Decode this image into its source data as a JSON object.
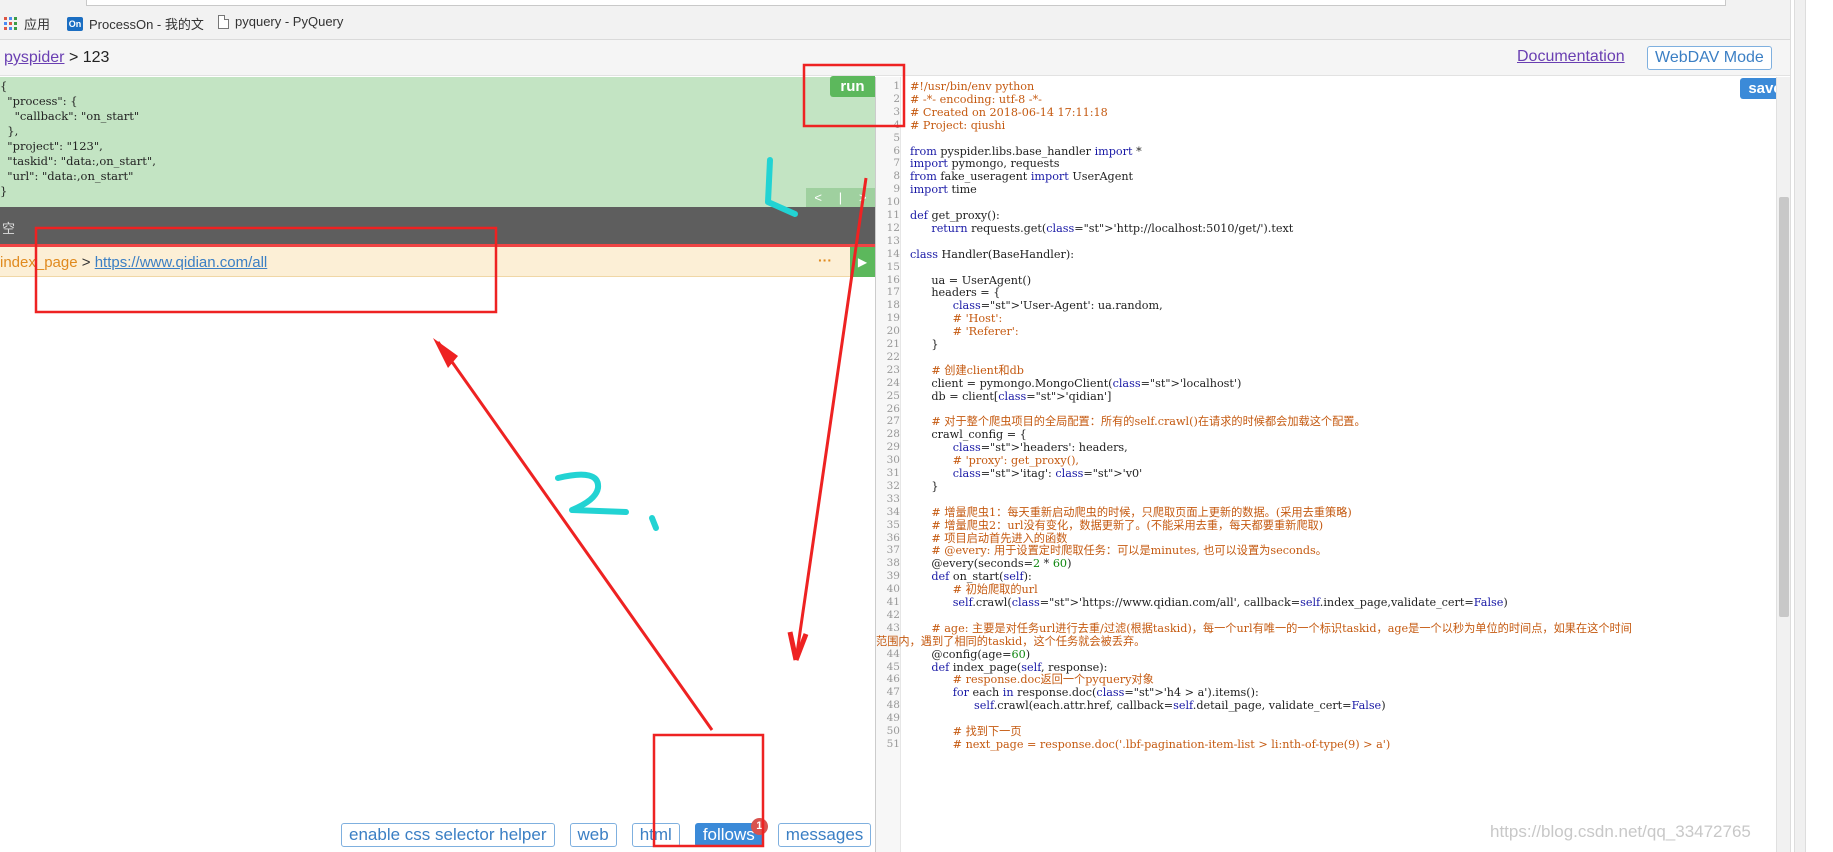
{
  "bookmarks": {
    "apps": "应用",
    "processon": "ProcessOn - 我的文",
    "pyquery": "pyquery - PyQuery"
  },
  "header": {
    "root_link": "pyspider",
    "separator": ">",
    "project": "123",
    "documentation": "Documentation",
    "webdav": "WebDAV Mode"
  },
  "task": {
    "json": "{\n  \"process\": {\n    \"callback\": \"on_start\"\n  },\n  \"project\": \"123\",\n  \"taskid\": \"data:,on_start\",\n  \"url\": \"data:,on_start\"\n}",
    "run_label": "run",
    "prev": "<",
    "next": ">"
  },
  "gray_bar_text": "空",
  "url_bar": {
    "callback": "index_page",
    "separator": ">",
    "url": "https://www.qidian.com/all",
    "more": "···",
    "play": "▶"
  },
  "tabs": [
    {
      "label": "enable css selector helper"
    },
    {
      "label": "web"
    },
    {
      "label": "html"
    },
    {
      "label": "follows",
      "badge": "1",
      "active": true
    },
    {
      "label": "messages"
    }
  ],
  "editor": {
    "save_label": "save",
    "lines": [
      {
        "n": "1",
        "t": "#!/usr/bin/env python",
        "k": "cm"
      },
      {
        "n": "2",
        "t": "# -*- encoding: utf-8 -*-",
        "k": "cm"
      },
      {
        "n": "3",
        "t": "# Created on 2018-06-14 17:11:18",
        "k": "cm"
      },
      {
        "n": "4",
        "t": "# Project: qiushi",
        "k": "cm"
      },
      {
        "n": "5",
        "t": "",
        "k": ""
      },
      {
        "n": "6",
        "t": "from pyspider.libs.base_handler import *",
        "k": ""
      },
      {
        "n": "7",
        "t": "import pymongo, requests",
        "k": ""
      },
      {
        "n": "8",
        "t": "from fake_useragent import UserAgent",
        "k": ""
      },
      {
        "n": "9",
        "t": "import time",
        "k": ""
      },
      {
        "n": "10",
        "t": "",
        "k": ""
      },
      {
        "n": "11",
        "t": "def get_proxy():",
        "k": ""
      },
      {
        "n": "12",
        "t": "      return requests.get('http://localhost:5010/get/').text",
        "k": ""
      },
      {
        "n": "13",
        "t": "",
        "k": ""
      },
      {
        "n": "14",
        "t": "class Handler(BaseHandler):",
        "k": ""
      },
      {
        "n": "15",
        "t": "",
        "k": ""
      },
      {
        "n": "16",
        "t": "      ua = UserAgent()",
        "k": ""
      },
      {
        "n": "17",
        "t": "      headers = {",
        "k": ""
      },
      {
        "n": "18",
        "t": "            'User-Agent': ua.random,",
        "k": ""
      },
      {
        "n": "19",
        "t": "            # 'Host':",
        "k": "cm"
      },
      {
        "n": "20",
        "t": "            # 'Referer':",
        "k": "cm"
      },
      {
        "n": "21",
        "t": "      }",
        "k": ""
      },
      {
        "n": "22",
        "t": "",
        "k": ""
      },
      {
        "n": "23",
        "t": "      # 创建client和db",
        "k": "cm"
      },
      {
        "n": "24",
        "t": "      client = pymongo.MongoClient('localhost')",
        "k": ""
      },
      {
        "n": "25",
        "t": "      db = client['qidian']",
        "k": ""
      },
      {
        "n": "26",
        "t": "",
        "k": ""
      },
      {
        "n": "27",
        "t": "      # 对于整个爬虫项目的全局配置：所有的self.crawl()在请求的时候都会加载这个配置。",
        "k": "cm"
      },
      {
        "n": "28",
        "t": "      crawl_config = {",
        "k": ""
      },
      {
        "n": "29",
        "t": "            'headers': headers,",
        "k": ""
      },
      {
        "n": "30",
        "t": "            # 'proxy': get_proxy(),",
        "k": "cm"
      },
      {
        "n": "31",
        "t": "            'itag': 'v0'",
        "k": ""
      },
      {
        "n": "32",
        "t": "      }",
        "k": ""
      },
      {
        "n": "33",
        "t": "",
        "k": ""
      },
      {
        "n": "34",
        "t": "      # 增量爬虫1：每天重新启动爬虫的时候，只爬取页面上更新的数据。(采用去重策略)",
        "k": "cm"
      },
      {
        "n": "35",
        "t": "      # 增量爬虫2：url没有变化，数据更新了。(不能采用去重，每天都要重新爬取)",
        "k": "cm"
      },
      {
        "n": "36",
        "t": "      # 项目启动首先进入的函数",
        "k": "cm"
      },
      {
        "n": "37",
        "t": "      # @every: 用于设置定时爬取任务：可以是minutes, 也可以设置为seconds。",
        "k": "cm"
      },
      {
        "n": "38",
        "t": "      @every(seconds=2 * 60)",
        "k": ""
      },
      {
        "n": "39",
        "t": "      def on_start(self):",
        "k": ""
      },
      {
        "n": "40",
        "t": "            # 初始爬取的url",
        "k": "cm"
      },
      {
        "n": "41",
        "t": "            self.crawl('https://www.qidian.com/all', callback=self.index_page,validate_cert=False)",
        "k": ""
      },
      {
        "n": "42",
        "t": "",
        "k": ""
      },
      {
        "n": "43",
        "t": "      # age: 主要是对任务url进行去重/过滤(根据taskid)，每一个url有唯一的一个标识taskid，age是一个以秒为单位的时间点，如果在这个时间",
        "k": "cm"
      },
      {
        "n": "",
        "t": "范围内，遇到了相同的taskid，这个任务就会被丢弃。",
        "k": "cm",
        "wrap": true
      },
      {
        "n": "44",
        "t": "      @config(age=60)",
        "k": ""
      },
      {
        "n": "45",
        "t": "      def index_page(self, response):",
        "k": ""
      },
      {
        "n": "46",
        "t": "            # response.doc返回一个pyquery对象",
        "k": "cm"
      },
      {
        "n": "47",
        "t": "            for each in response.doc('h4 > a').items():",
        "k": ""
      },
      {
        "n": "48",
        "t": "                  self.crawl(each.attr.href, callback=self.detail_page, validate_cert=False)",
        "k": ""
      },
      {
        "n": "49",
        "t": "",
        "k": ""
      },
      {
        "n": "50",
        "t": "            # 找到下一页",
        "k": "cm"
      },
      {
        "n": "51",
        "t": "            # next_page = response.doc('.lbf-pagination-item-list > li:nth-of-type(9) > a')",
        "k": "cm"
      }
    ]
  },
  "annotations": {
    "label_1": "1、",
    "label_2": "2、"
  },
  "watermark": "https://blog.csdn.net/qq_33472765",
  "colors": {
    "task_bg": "#c3e4c3",
    "run": "#5cb85c",
    "save": "#3b8ad8",
    "annotation_red": "#ee2222",
    "annotation_cyan": "#22d3d3"
  }
}
